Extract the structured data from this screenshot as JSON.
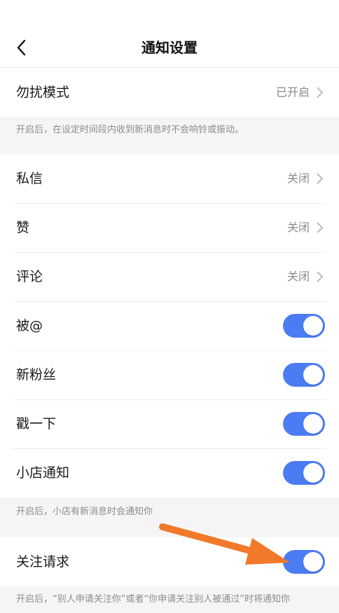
{
  "header": {
    "title": "通知设置",
    "back_icon": "chevron-left-icon"
  },
  "dnd": {
    "label": "勿扰模式",
    "value": "已开启",
    "note": "开启后，在设定时间段内收到新消息时不会响铃或振动。"
  },
  "rows": [
    {
      "label": "私信",
      "value": "关闭"
    },
    {
      "label": "赞",
      "value": "关闭"
    },
    {
      "label": "评论",
      "value": "关闭"
    }
  ],
  "toggles": [
    {
      "label": "被@",
      "on": true
    },
    {
      "label": "新粉丝",
      "on": true
    },
    {
      "label": "戳一下",
      "on": true
    },
    {
      "label": "小店通知",
      "on": true
    }
  ],
  "shop_note": "开启后，小店有新消息时会通知你",
  "follow": {
    "label": "关注请求",
    "on": true,
    "note": "开启后，“别人申请关注你”或者“你申请关注别人被通过”时将通知你"
  },
  "colors": {
    "toggle_on": "#4c7cf3",
    "annotation_arrow": "#f07a2a"
  }
}
